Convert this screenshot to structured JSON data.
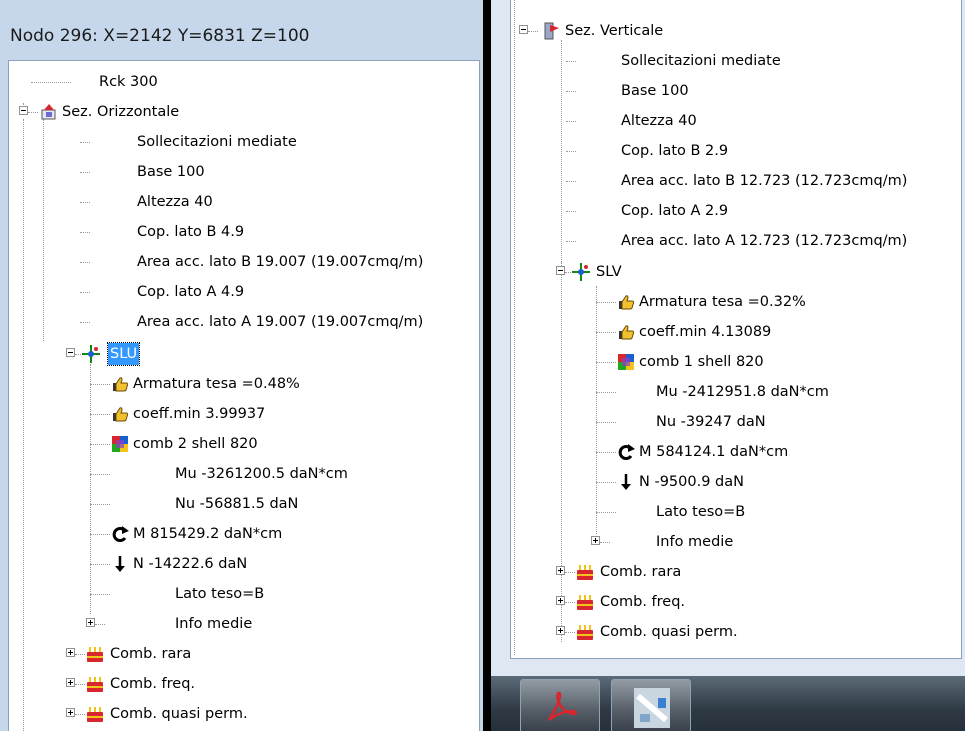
{
  "left": {
    "title": "Nodo 296: X=2142 Y=6831 Z=100",
    "tree": [
      {
        "id": "rck",
        "label": "Rck 300",
        "icon": null
      },
      {
        "id": "sez-orizzontale",
        "label": "Sez. Orizzontale",
        "icon": "section-icon"
      },
      {
        "id": "sollecitazioni",
        "label": "Sollecitazioni mediate",
        "icon": null
      },
      {
        "id": "base",
        "label": "Base 100",
        "icon": null
      },
      {
        "id": "altezza",
        "label": "Altezza 40",
        "icon": null
      },
      {
        "id": "cop-b",
        "label": "Cop. lato B 4.9",
        "icon": null
      },
      {
        "id": "area-b",
        "label": "Area acc. lato B  19.007 (19.007cmq/m)",
        "icon": null
      },
      {
        "id": "cop-a",
        "label": "Cop. lato A 4.9",
        "icon": null
      },
      {
        "id": "area-a",
        "label": "Area acc. lato A  19.007 (19.007cmq/m)",
        "icon": null
      },
      {
        "id": "slu",
        "label": "SLU",
        "icon": "target-icon"
      },
      {
        "id": "armatura",
        "label": "Armatura tesa =0.48%",
        "icon": "thumbs-up-icon"
      },
      {
        "id": "coeff",
        "label": "coeff.min 3.99937",
        "icon": "thumbs-up-icon"
      },
      {
        "id": "comb",
        "label": "comb 2 shell 820",
        "icon": "shell-icon"
      },
      {
        "id": "mu",
        "label": "Mu -3261200.5 daN*cm",
        "icon": null
      },
      {
        "id": "nu",
        "label": "Nu -56881.5 daN",
        "icon": null
      },
      {
        "id": "m",
        "label": "M 815429.2 daN*cm",
        "icon": "moment-icon"
      },
      {
        "id": "n",
        "label": "N -14222.6 daN",
        "icon": "arrow-down-icon"
      },
      {
        "id": "lato-teso",
        "label": "Lato teso=B",
        "icon": null
      },
      {
        "id": "info-medie",
        "label": "Info medie",
        "icon": null
      },
      {
        "id": "comb-rara",
        "label": "Comb. rara",
        "icon": "comb-icon"
      },
      {
        "id": "comb-freq",
        "label": "Comb. freq.",
        "icon": "comb-icon"
      },
      {
        "id": "comb-quasi",
        "label": "Comb. quasi perm.",
        "icon": "comb-icon"
      }
    ]
  },
  "right": {
    "tree": [
      {
        "id": "sez-verticale",
        "label": "Sez. Verticale",
        "icon": "section-v-icon"
      },
      {
        "id": "sollecitazioni",
        "label": "Sollecitazioni mediate",
        "icon": null
      },
      {
        "id": "base",
        "label": "Base 100",
        "icon": null
      },
      {
        "id": "altezza",
        "label": "Altezza 40",
        "icon": null
      },
      {
        "id": "cop-b",
        "label": "Cop. lato B 2.9",
        "icon": null
      },
      {
        "id": "area-b",
        "label": "Area acc. lato B  12.723 (12.723cmq/m)",
        "icon": null
      },
      {
        "id": "cop-a",
        "label": "Cop. lato A 2.9",
        "icon": null
      },
      {
        "id": "area-a",
        "label": "Area acc. lato A  12.723 (12.723cmq/m)",
        "icon": null
      },
      {
        "id": "slv",
        "label": "SLV",
        "icon": "target-icon"
      },
      {
        "id": "armatura",
        "label": "Armatura tesa =0.32%",
        "icon": "thumbs-up-icon"
      },
      {
        "id": "coeff",
        "label": "coeff.min 4.13089",
        "icon": "thumbs-up-icon"
      },
      {
        "id": "comb",
        "label": "comb 1 shell 820",
        "icon": "shell-icon"
      },
      {
        "id": "mu",
        "label": "Mu -2412951.8 daN*cm",
        "icon": null
      },
      {
        "id": "nu",
        "label": "Nu -39247 daN",
        "icon": null
      },
      {
        "id": "m",
        "label": "M 584124.1 daN*cm",
        "icon": "moment-icon"
      },
      {
        "id": "n",
        "label": "N -9500.9 daN",
        "icon": "arrow-down-icon"
      },
      {
        "id": "lato-teso",
        "label": "Lato teso=B",
        "icon": null
      },
      {
        "id": "info-medie",
        "label": "Info medie",
        "icon": null
      },
      {
        "id": "comb-rara",
        "label": "Comb. rara",
        "icon": "comb-icon"
      },
      {
        "id": "comb-freq",
        "label": "Comb. freq.",
        "icon": "comb-icon"
      },
      {
        "id": "comb-quasi",
        "label": "Comb. quasi perm.",
        "icon": "comb-icon"
      }
    ]
  },
  "taskbar": {
    "buttons": [
      {
        "icon": "pdf-icon"
      },
      {
        "icon": "app-thumbnail-icon"
      }
    ]
  },
  "colors": {
    "selection": "#3399ff",
    "accent_red": "#d7262d"
  }
}
